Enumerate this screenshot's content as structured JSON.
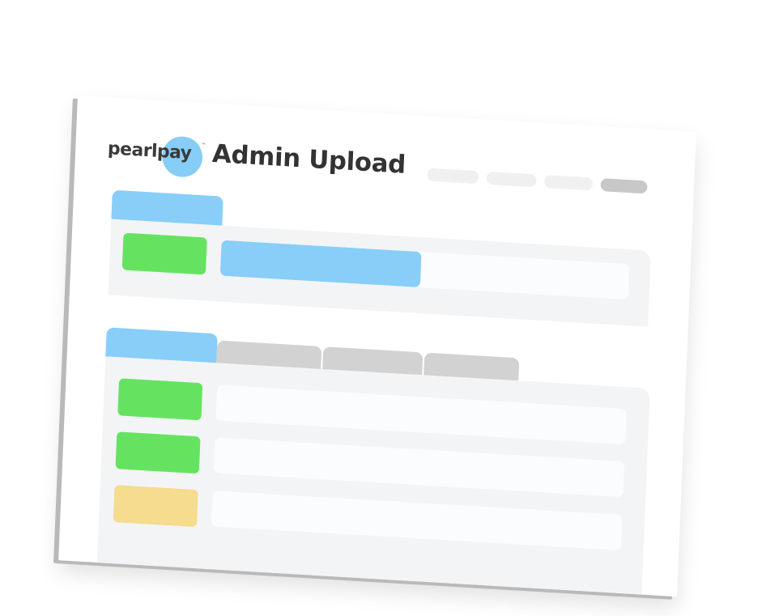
{
  "app": {
    "logo_text": "pearlpay",
    "logo_tm": "™",
    "title": "Admin Upload"
  },
  "colors": {
    "brand_blue": "#88cef8",
    "status_green": "#65e360",
    "status_yellow": "#f5dc8e",
    "panel_bg": "#f3f4f5",
    "inactive_tab": "#d2d2d2"
  },
  "nav": {
    "items": [
      "",
      "",
      "",
      ""
    ],
    "active_index": 3
  },
  "upload_section": {
    "tab_label": "",
    "status": "success",
    "progress": 0.49
  },
  "list_section": {
    "tabs": [
      {
        "label": "",
        "active": true
      },
      {
        "label": "",
        "active": false
      },
      {
        "label": "",
        "active": false
      },
      {
        "label": "",
        "active": false
      }
    ],
    "rows": [
      {
        "status": "success",
        "text": ""
      },
      {
        "status": "success",
        "text": ""
      },
      {
        "status": "pending",
        "text": ""
      }
    ]
  }
}
